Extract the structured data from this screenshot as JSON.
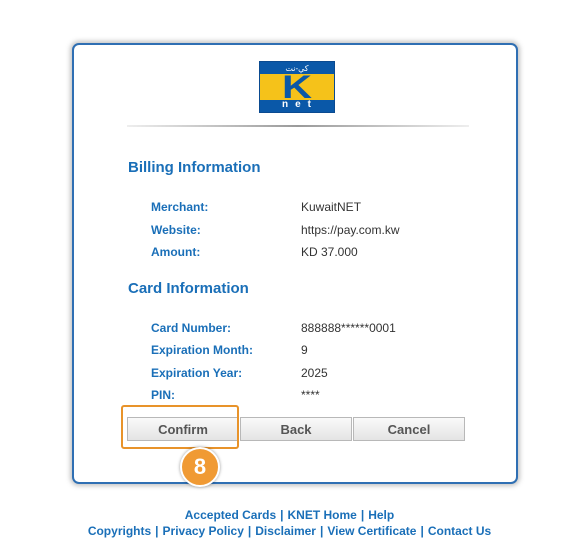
{
  "logo": {
    "top_text": "كي-نت",
    "letter": "K",
    "bottom_text": "net"
  },
  "billing": {
    "title": "Billing Information",
    "rows": [
      {
        "label": "Merchant:",
        "value": "KuwaitNET"
      },
      {
        "label": "Website:",
        "value": "https://pay.com.kw"
      },
      {
        "label": "Amount:",
        "value": "KD 37.000"
      }
    ]
  },
  "card": {
    "title": "Card Information",
    "rows": [
      {
        "label": "Card Number:",
        "value": "888888******0001"
      },
      {
        "label": "Expiration Month:",
        "value": "9"
      },
      {
        "label": "Expiration Year:",
        "value": "2025"
      },
      {
        "label": "PIN:",
        "value": "****"
      }
    ]
  },
  "buttons": {
    "confirm": "Confirm",
    "back": "Back",
    "cancel": "Cancel"
  },
  "step_badge": "8",
  "footer": {
    "line1": [
      "Accepted Cards",
      "KNET Home",
      "Help"
    ],
    "line2": [
      "Copyrights",
      "Privacy Policy",
      "Disclaimer",
      "View Certificate",
      "Contact Us"
    ]
  },
  "colors": {
    "accent": "#1a6fb8",
    "highlight": "#e8932a",
    "badge": "#f09a34"
  }
}
